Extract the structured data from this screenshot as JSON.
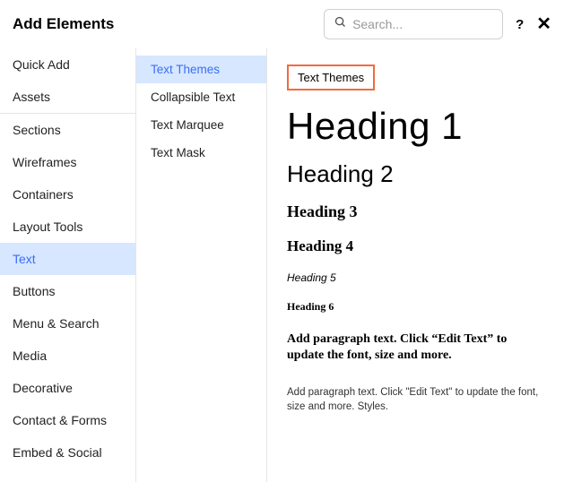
{
  "header": {
    "title": "Add Elements",
    "search_placeholder": "Search...",
    "help": "?",
    "close": "✕"
  },
  "categories": {
    "group1": [
      {
        "label": "Quick Add"
      },
      {
        "label": "Assets"
      }
    ],
    "group2": [
      {
        "label": "Sections"
      },
      {
        "label": "Wireframes"
      },
      {
        "label": "Containers"
      },
      {
        "label": "Layout Tools"
      },
      {
        "label": "Text",
        "active": true
      },
      {
        "label": "Buttons"
      },
      {
        "label": "Menu & Search"
      },
      {
        "label": "Media"
      },
      {
        "label": "Decorative"
      },
      {
        "label": "Contact & Forms"
      },
      {
        "label": "Embed & Social"
      }
    ]
  },
  "subcategories": [
    {
      "label": "Text Themes",
      "active": true
    },
    {
      "label": "Collapsible Text"
    },
    {
      "label": "Text Marquee"
    },
    {
      "label": "Text Mask"
    }
  ],
  "preview": {
    "section_label": "Text Themes",
    "h1": "Heading 1",
    "h2": "Heading 2",
    "h3": "Heading 3",
    "h4": "Heading 4",
    "h5": "Heading 5",
    "h6": "Heading 6",
    "p1": "Add paragraph text. Click “Edit Text” to update the font, size and more.",
    "p2": "Add paragraph text. Click \"Edit Text\" to update the font, size and more. Styles."
  }
}
